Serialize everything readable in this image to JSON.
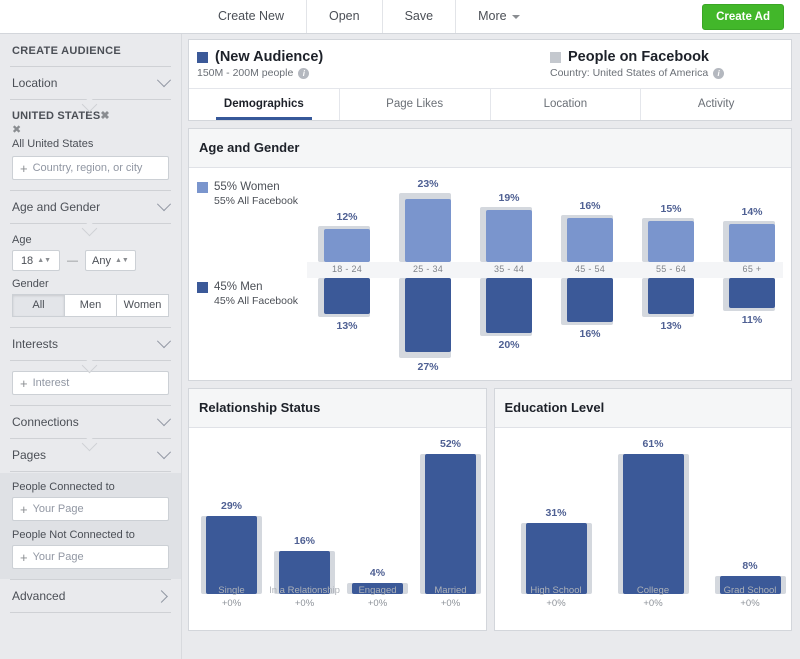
{
  "toolbar": {
    "items": [
      {
        "label": "Create New"
      },
      {
        "label": "Open"
      },
      {
        "label": "Save"
      },
      {
        "label": "More"
      }
    ],
    "create_ad_label": "Create Ad"
  },
  "sidebar": {
    "title": "CREATE AUDIENCE",
    "location": {
      "header": "Location",
      "country_label": "UNITED STATES",
      "all_label": "All United States",
      "input_placeholder": "Country, region, or city"
    },
    "age_gender": {
      "header": "Age and Gender",
      "age_label": "Age",
      "age_min": "18",
      "age_max": "Any",
      "gender_label": "Gender",
      "gender_options": [
        "All",
        "Men",
        "Women"
      ],
      "gender_selected": "All"
    },
    "interests": {
      "header": "Interests",
      "input_placeholder": "Interest"
    },
    "connections": {
      "header": "Connections"
    },
    "pages": {
      "header": "Pages",
      "connected_label": "People Connected to",
      "connected_placeholder": "Your Page",
      "not_connected_label": "People Not Connected to",
      "not_connected_placeholder": "Your Page"
    },
    "advanced": {
      "header": "Advanced"
    }
  },
  "header": {
    "audience": {
      "title": "(New Audience)",
      "subtitle": "150M - 200M people"
    },
    "comparison": {
      "title": "People on Facebook",
      "subtitle": "Country: United States of America"
    }
  },
  "tabs": [
    {
      "label": "Demographics",
      "active": true
    },
    {
      "label": "Page Likes",
      "active": false
    },
    {
      "label": "Location",
      "active": false
    },
    {
      "label": "Activity",
      "active": false
    }
  ],
  "colors": {
    "women": "#7a95cd",
    "men": "#3b5998",
    "shadow": "#d4d8de",
    "accent": "#365899",
    "create_ad": "#42b72a"
  },
  "panels": {
    "age_gender": {
      "title": "Age and Gender",
      "legend_women": "55% Women",
      "legend_women_sub": "55% All Facebook",
      "legend_men": "45% Men",
      "legend_men_sub": "45% All Facebook"
    },
    "relationship": {
      "title": "Relationship Status"
    },
    "education": {
      "title": "Education Level"
    }
  },
  "chart_data": [
    {
      "type": "bar",
      "title": "Age and Gender",
      "orientation": "diverging-vertical",
      "categories": [
        "18 - 24",
        "25 - 34",
        "35 - 44",
        "45 - 54",
        "55 - 64",
        "65 +"
      ],
      "series": [
        {
          "name": "55% Women",
          "color": "#7a95cd",
          "values": [
            12,
            23,
            19,
            16,
            15,
            14
          ],
          "labels": [
            "12%",
            "23%",
            "19%",
            "16%",
            "15%",
            "14%"
          ]
        },
        {
          "name": "45% Men",
          "color": "#3b5998",
          "values": [
            13,
            27,
            20,
            16,
            13,
            11
          ],
          "labels": [
            "13%",
            "27%",
            "20%",
            "16%",
            "13%",
            "11%"
          ]
        }
      ],
      "comparison_series": [
        {
          "name": "All Facebook Women",
          "values": [
            13,
            25,
            20,
            17,
            16,
            15
          ]
        },
        {
          "name": "All Facebook Men",
          "values": [
            14,
            29,
            21,
            17,
            14,
            12
          ]
        }
      ],
      "ylim": [
        0,
        30
      ],
      "grid": false,
      "legend": "left"
    },
    {
      "type": "bar",
      "title": "Relationship Status",
      "categories": [
        "Single",
        "In a Relationship",
        "Engaged",
        "Married"
      ],
      "values": [
        29,
        16,
        4,
        52
      ],
      "labels": [
        "29%",
        "16%",
        "4%",
        "52%"
      ],
      "deltas": [
        "+0%",
        "+0%",
        "+0%",
        "+0%"
      ],
      "comparison_values": [
        29,
        16,
        4,
        52
      ],
      "ylim": [
        0,
        60
      ],
      "grid": false,
      "legend": "none"
    },
    {
      "type": "bar",
      "title": "Education Level",
      "categories": [
        "High School",
        "College",
        "Grad School"
      ],
      "values": [
        31,
        61,
        8
      ],
      "labels": [
        "31%",
        "61%",
        "8%"
      ],
      "deltas": [
        "+0%",
        "+0%",
        "+0%"
      ],
      "comparison_values": [
        31,
        61,
        8
      ],
      "ylim": [
        0,
        70
      ],
      "grid": false,
      "legend": "none"
    }
  ]
}
